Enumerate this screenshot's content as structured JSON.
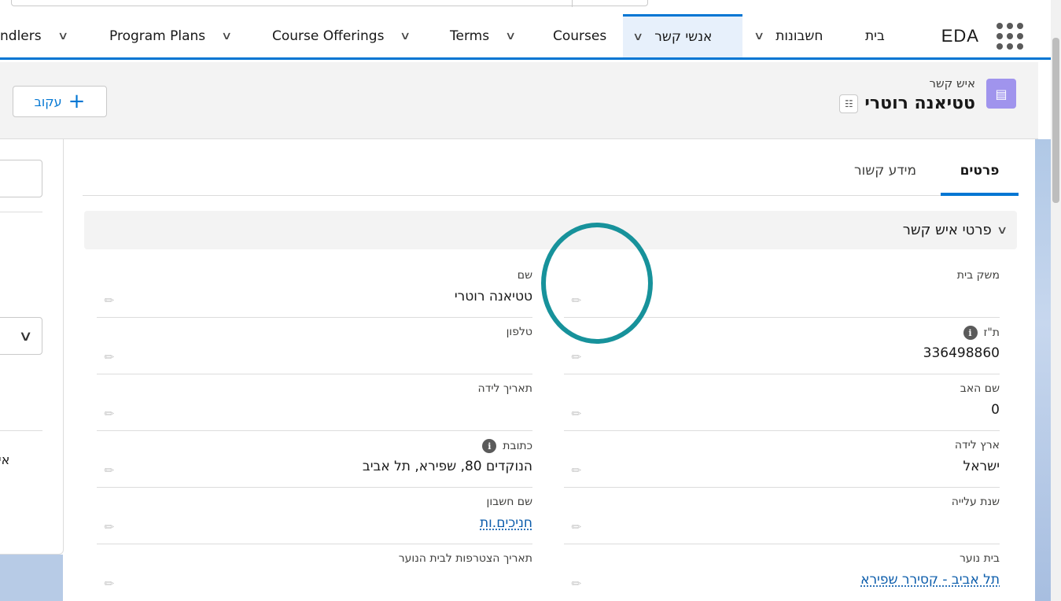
{
  "app": {
    "name": "EDA",
    "launcher_icon": "app-launcher-icon"
  },
  "nav": {
    "items": [
      {
        "label": "ndlers",
        "has_chevron": true
      },
      {
        "label": "Program Plans",
        "has_chevron": true
      },
      {
        "label": "Course Offerings",
        "has_chevron": true
      },
      {
        "label": "Terms",
        "has_chevron": true
      },
      {
        "label": "Courses",
        "has_chevron": true
      },
      {
        "label": "אנשי קשר",
        "has_chevron": true,
        "active": true
      },
      {
        "label": "חשבונות",
        "has_chevron": true
      },
      {
        "label": "בית",
        "has_chevron": false
      }
    ]
  },
  "header": {
    "record_type": "איש קשר",
    "record_name": "טטיאנה רוטרי",
    "icon": "contact-card-icon",
    "follow_label": "עקוב"
  },
  "tabs": [
    {
      "label": "פרטים",
      "active": true
    },
    {
      "label": "מידע קשור",
      "active": false
    }
  ],
  "section": {
    "title": "פרטי איש קשר"
  },
  "fields": {
    "household": {
      "label": "משק בית",
      "value": ""
    },
    "name": {
      "label": "שם",
      "value": "טטיאנה רוטרי"
    },
    "id_number": {
      "label": "ת\"ז",
      "value": "336498860"
    },
    "phone": {
      "label": "טלפון",
      "value": ""
    },
    "father_name": {
      "label": "שם האב",
      "value": "0"
    },
    "birth_date": {
      "label": "תאריך לידה",
      "value": ""
    },
    "birth_country": {
      "label": "ארץ לידה",
      "value": "ישראל"
    },
    "address": {
      "label": "כתובת",
      "value": "הנוקדים 80, שפירא, תל אביב"
    },
    "aliyah_year": {
      "label": "שנת עלייה",
      "value": ""
    },
    "account_name": {
      "label": "שם חשבון",
      "value": "חניכים.ות"
    },
    "youth_house": {
      "label": "בית נוער",
      "value": "תל אביב - קסירר שפירא"
    },
    "join_date": {
      "label": "תאריך הצטרפות לבית הנוער",
      "value": ""
    }
  },
  "left_panel": {
    "text": "אי"
  },
  "colors": {
    "accent": "#0176d3",
    "contact_icon": "#a094ed",
    "annotation_circle": "#17929b"
  }
}
